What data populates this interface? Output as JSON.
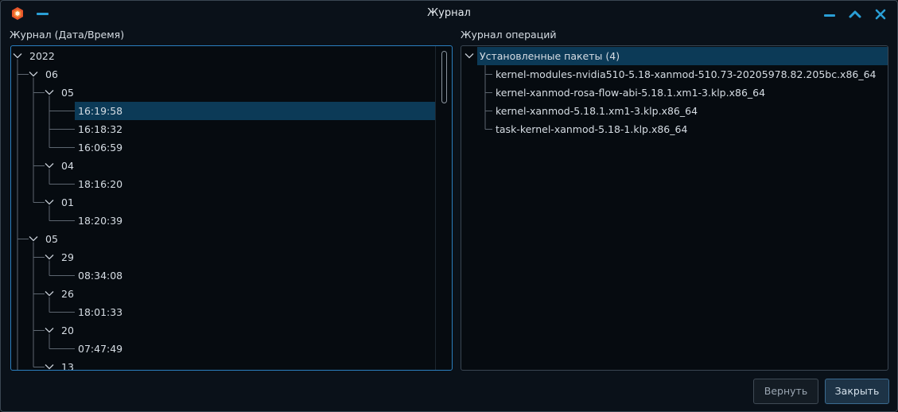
{
  "window": {
    "title": "Журнал"
  },
  "left_pane": {
    "label": "Журнал (Дата/Время)",
    "tree": [
      {
        "text": "2022",
        "level": 0,
        "expanded": true
      },
      {
        "text": "06",
        "level": 1,
        "expanded": true
      },
      {
        "text": "05",
        "level": 2,
        "expanded": true
      },
      {
        "text": "16:19:58",
        "level": 3,
        "selected": true
      },
      {
        "text": "16:18:32",
        "level": 3
      },
      {
        "text": "16:06:59",
        "level": 3
      },
      {
        "text": "04",
        "level": 2,
        "expanded": true
      },
      {
        "text": "18:16:20",
        "level": 3
      },
      {
        "text": "01",
        "level": 2,
        "expanded": true
      },
      {
        "text": "18:20:39",
        "level": 3
      },
      {
        "text": "05",
        "level": 1,
        "expanded": true
      },
      {
        "text": "29",
        "level": 2,
        "expanded": true
      },
      {
        "text": "08:34:08",
        "level": 3
      },
      {
        "text": "26",
        "level": 2,
        "expanded": true
      },
      {
        "text": "18:01:33",
        "level": 3
      },
      {
        "text": "20",
        "level": 2,
        "expanded": true
      },
      {
        "text": "07:47:49",
        "level": 3
      },
      {
        "text": "13",
        "level": 2,
        "expanded": true
      }
    ]
  },
  "right_pane": {
    "label": "Журнал операций",
    "group": {
      "text": "Установленные пакеты (4)",
      "expanded": true
    },
    "packages": [
      "kernel-modules-nvidia510-5.18-xanmod-510.73-20205978.82.205bc.x86_64",
      "kernel-xanmod-rosa-flow-abi-5.18.1.xm1-3.klp.x86_64",
      "kernel-xanmod-5.18.1.xm1-3.klp.x86_64",
      "task-kernel-xanmod-5.18-1.klp.x86_64"
    ]
  },
  "buttons": {
    "revert": "Вернуть",
    "close": "Закрыть"
  },
  "colors": {
    "accent": "#2a9fd6",
    "selection": "#0c3a57",
    "background": "#0a1119"
  },
  "icons": {
    "app": "package-box-icon",
    "minimize": "minimize-icon",
    "maximize": "chevron-up-icon",
    "close": "close-icon"
  }
}
